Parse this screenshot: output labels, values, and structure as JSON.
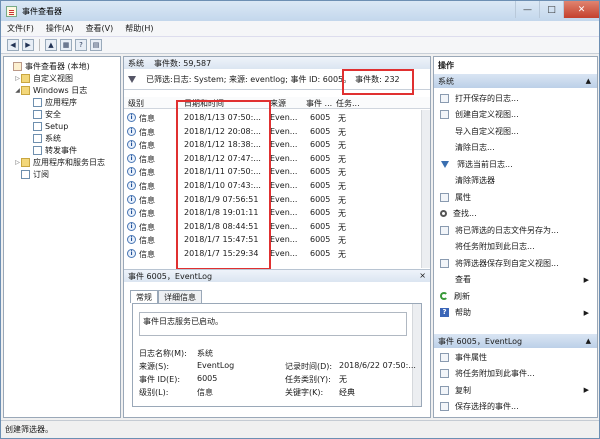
{
  "window": {
    "title": "事件查看器"
  },
  "menu": [
    "文件(F)",
    "操作(A)",
    "查看(V)",
    "帮助(H)"
  ],
  "tree": {
    "root": "事件查看器 (本地)",
    "custom_views": "自定义视图",
    "windows_logs": "Windows 日志",
    "logs": [
      "应用程序",
      "安全",
      "Setup",
      "系统",
      "转发事件"
    ],
    "apps_services": "应用程序和服务日志",
    "subscriptions": "订阅"
  },
  "log": {
    "name": "系统",
    "count_label": "事件数: 59,587",
    "filter_text": "已筛选:日志: System; 来源: eventlog; 事件 ID: 6005。",
    "filtered_count": "事件数: 232"
  },
  "columns": {
    "level": "级别",
    "datetime": "日期和时间",
    "source": "来源",
    "eventid": "事件 ...",
    "task": "任务..."
  },
  "events": [
    {
      "level": "信息",
      "datetime": "2018/1/13 07:50:...",
      "source": "Even...",
      "id": "6005",
      "task": "无"
    },
    {
      "level": "信息",
      "datetime": "2018/1/12 20:08:...",
      "source": "Even...",
      "id": "6005",
      "task": "无"
    },
    {
      "level": "信息",
      "datetime": "2018/1/12 18:38:...",
      "source": "Even...",
      "id": "6005",
      "task": "无"
    },
    {
      "level": "信息",
      "datetime": "2018/1/12 07:47:...",
      "source": "Even...",
      "id": "6005",
      "task": "无"
    },
    {
      "level": "信息",
      "datetime": "2018/1/11 07:50:...",
      "source": "Even...",
      "id": "6005",
      "task": "无"
    },
    {
      "level": "信息",
      "datetime": "2018/1/10 07:43:...",
      "source": "Even...",
      "id": "6005",
      "task": "无"
    },
    {
      "level": "信息",
      "datetime": "2018/1/9 07:56:51",
      "source": "Even...",
      "id": "6005",
      "task": "无"
    },
    {
      "level": "信息",
      "datetime": "2018/1/8 19:01:11",
      "source": "Even...",
      "id": "6005",
      "task": "无"
    },
    {
      "level": "信息",
      "datetime": "2018/1/8 08:44:51",
      "source": "Even...",
      "id": "6005",
      "task": "无"
    },
    {
      "level": "信息",
      "datetime": "2018/1/7 15:47:51",
      "source": "Even...",
      "id": "6005",
      "task": "无"
    },
    {
      "level": "信息",
      "datetime": "2018/1/7 15:29:34",
      "source": "Even...",
      "id": "6005",
      "task": "无"
    }
  ],
  "detail": {
    "header": "事件 6005，EventLog",
    "close": "×",
    "tab_general": "常规",
    "tab_details": "详细信息",
    "message": "事件日志服务已启动。",
    "log_name_label": "日志名称(M):",
    "log_name": "系统",
    "source_label": "来源(S):",
    "source": "EventLog",
    "logged_label": "记录时间(D):",
    "logged": "2018/6/22 07:50:...",
    "eventid_label": "事件 ID(E):",
    "eventid": "6005",
    "category_label": "任务类别(Y):",
    "category": "无",
    "level_label": "级别(L):",
    "level": "信息",
    "keywords_label": "关键字(K):",
    "keywords": "经典"
  },
  "actions": {
    "title": "操作",
    "section1": "系统",
    "items1": [
      "打开保存的日志...",
      "创建自定义视图...",
      "导入自定义视图...",
      "清除日志...",
      "筛选当前日志...",
      "清除筛选器",
      "属性",
      "查找...",
      "将已筛选的日志文件另存为...",
      "将任务附加到此日志...",
      "将筛选器保存到自定义视图...",
      "查看",
      "刷新",
      "帮助"
    ],
    "section2": "事件 6005，EventLog",
    "items2": [
      "事件属性",
      "将任务附加到此事件...",
      "复制",
      "保存选择的事件..."
    ]
  },
  "status": "创建筛选器。"
}
